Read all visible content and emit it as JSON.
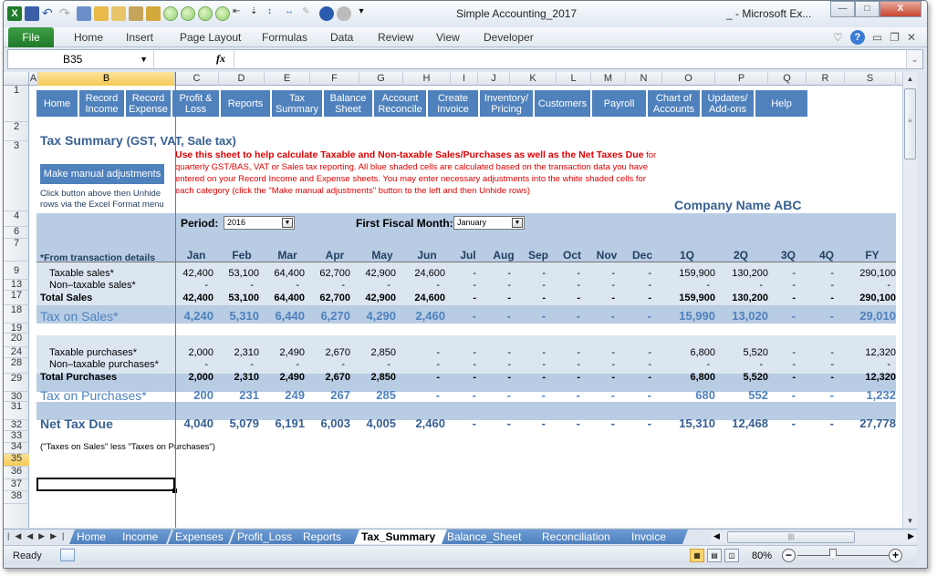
{
  "window": {
    "title": "Simple Accounting_2017",
    "app": "_ - Microsoft Ex...",
    "min_icon": "minimize-icon",
    "max_icon": "maximize-icon",
    "close_label": "X"
  },
  "ribbon": {
    "file": "File",
    "tabs": [
      "Home",
      "Insert",
      "Page Layout",
      "Formulas",
      "Data",
      "Review",
      "View",
      "Developer"
    ]
  },
  "formula_bar": {
    "name_box": "B35",
    "fx": "fx",
    "value": ""
  },
  "columns": [
    "A",
    "B",
    "C",
    "D",
    "E",
    "F",
    "G",
    "H",
    "I",
    "J",
    "K",
    "L",
    "M",
    "N",
    "O",
    "P",
    "Q",
    "R",
    "S"
  ],
  "rows": [
    "1",
    "2",
    "3",
    "4",
    "6",
    "7",
    "9",
    "13",
    "17",
    "18",
    "19",
    "20",
    "24",
    "28",
    "29",
    "30",
    "31",
    "32",
    "33",
    "34",
    "35",
    "36",
    "37",
    "38"
  ],
  "nav_buttons": [
    "Home",
    "Record\nIncome",
    "Record\nExpense",
    "Profit &\nLoss",
    "Reports",
    "Tax\nSummary",
    "Balance\nSheet",
    "Account\nReconcile",
    "Create\nInvoice",
    "Inventory/\nPricing",
    "Customers",
    "Payroll",
    "Chart of\nAccounts",
    "Updates/\nAdd-ons",
    "Help"
  ],
  "sheet": {
    "title": "Tax Summary",
    "subtitle": "(GST, VAT, Sale tax)",
    "manual_button": "Make manual adjustments",
    "manual_note_1": "Click button above then Unhide",
    "manual_note_2": "rows via the Excel Format menu",
    "instructions_bold_1": "Use this sheet to help calculate Taxable and Non-taxable Sales/Purchases as well as the Net",
    "instructions_bold_2": "Taxes Due",
    "instructions_rest": " for quarterly GST/BAS, VAT or Sales tax reporting. All blue shaded cells are calculated based on the transaction data you have entered on your Record Income and Expense sheets. You may enter necessary adjustments into the white shaded cells  for each category (click the \"Make manual adjustments\" button to the left and then Unhide rows)",
    "company": "Company Name ABC",
    "period_label": "Period:",
    "period_value": "2016",
    "fiscal_label": "First Fiscal Month:",
    "fiscal_value": "January",
    "from_details": "*From transaction details",
    "col_headers": [
      "Jan",
      "Feb",
      "Mar",
      "Apr",
      "May",
      "Jun",
      "Jul",
      "Aug",
      "Sep",
      "Oct",
      "Nov",
      "Dec",
      "1Q",
      "2Q",
      "3Q",
      "4Q",
      "FY"
    ],
    "table": [
      {
        "label": "Taxable sales*",
        "style": "item",
        "values": [
          "42,400",
          "53,100",
          "64,400",
          "62,700",
          "42,900",
          "24,600",
          "-",
          "-",
          "-",
          "-",
          "-",
          "-",
          "159,900",
          "130,200",
          "-",
          "-",
          "290,100"
        ]
      },
      {
        "label": "Non–taxable sales*",
        "style": "item",
        "values": [
          "-",
          "-",
          "-",
          "-",
          "-",
          "-",
          "-",
          "-",
          "-",
          "-",
          "-",
          "-",
          "-",
          "-",
          "-",
          "-",
          "-"
        ]
      },
      {
        "label": "Total Sales",
        "style": "total",
        "values": [
          "42,400",
          "53,100",
          "64,400",
          "62,700",
          "42,900",
          "24,600",
          "-",
          "-",
          "-",
          "-",
          "-",
          "-",
          "159,900",
          "130,200",
          "-",
          "-",
          "290,100"
        ]
      },
      {
        "label": "Tax on Sales*",
        "style": "tax",
        "values": [
          "4,240",
          "5,310",
          "6,440",
          "6,270",
          "4,290",
          "2,460",
          "-",
          "-",
          "-",
          "-",
          "-",
          "-",
          "15,990",
          "13,020",
          "-",
          "-",
          "29,010"
        ]
      },
      {
        "label": "Taxable purchases*",
        "style": "item",
        "values": [
          "2,000",
          "2,310",
          "2,490",
          "2,670",
          "2,850",
          "-",
          "-",
          "-",
          "-",
          "-",
          "-",
          "-",
          "6,800",
          "5,520",
          "-",
          "-",
          "12,320"
        ]
      },
      {
        "label": "Non–taxable purchases*",
        "style": "item",
        "values": [
          "-",
          "-",
          "-",
          "-",
          "-",
          "-",
          "-",
          "-",
          "-",
          "-",
          "-",
          "-",
          "-",
          "-",
          "-",
          "-",
          "-"
        ]
      },
      {
        "label": "Total Purchases",
        "style": "total",
        "values": [
          "2,000",
          "2,310",
          "2,490",
          "2,670",
          "2,850",
          "-",
          "-",
          "-",
          "-",
          "-",
          "-",
          "-",
          "6,800",
          "5,520",
          "-",
          "-",
          "12,320"
        ]
      },
      {
        "label": "Tax on Purchases*",
        "style": "tax",
        "values": [
          "200",
          "231",
          "249",
          "267",
          "285",
          "-",
          "-",
          "-",
          "-",
          "-",
          "-",
          "-",
          "680",
          "552",
          "-",
          "-",
          "1,232"
        ]
      },
      {
        "label": "Net Tax Due",
        "style": "net",
        "values": [
          "4,040",
          "5,079",
          "6,191",
          "6,003",
          "4,005",
          "2,460",
          "-",
          "-",
          "-",
          "-",
          "-",
          "-",
          "15,310",
          "12,468",
          "-",
          "-",
          "27,778"
        ]
      }
    ],
    "net_note": "(\"Taxes on Sales\" less \"Taxes on Purchases\")"
  },
  "sheet_tabs": [
    "Home",
    "Income",
    "Expenses",
    "Profit_Loss",
    "Reports",
    "Tax_Summary",
    "Balance_Sheet",
    "Reconciliation",
    "Invoice"
  ],
  "active_tab": "Tax_Summary",
  "status": {
    "ready": "Ready",
    "zoom": "80%",
    "zoom_level_percent": 80
  },
  "colors": {
    "nav_blue": "#4f81bd",
    "band_light": "#dce6f1",
    "band_mid": "#b8cce4",
    "title_blue": "#376092",
    "instruction_red": "#e00000"
  }
}
